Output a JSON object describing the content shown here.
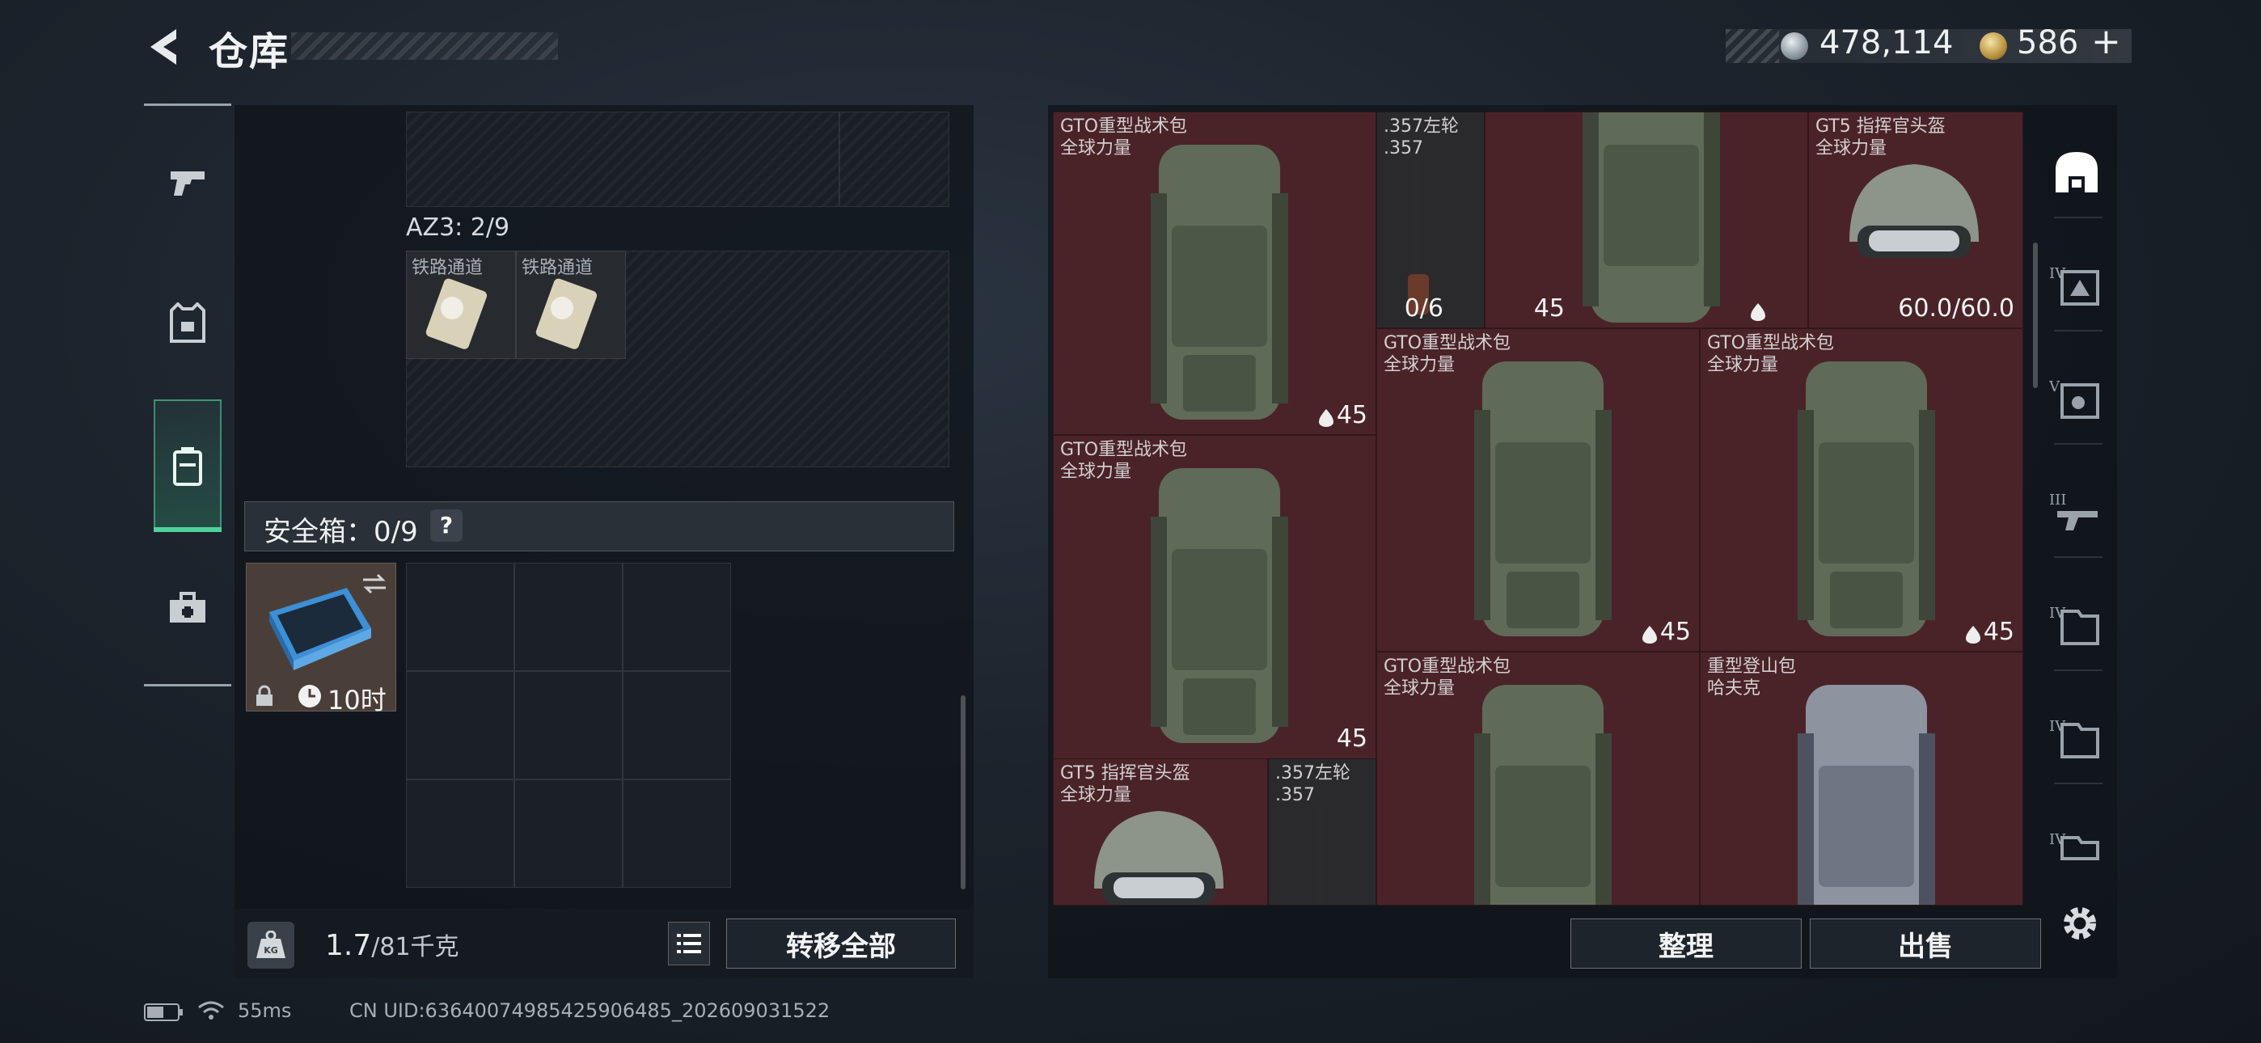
{
  "header": {
    "title": "仓库",
    "currency_silver": "478,114",
    "currency_gold": "586",
    "add_symbol": "+"
  },
  "left_nav": {
    "items": [
      {
        "icon": "pistol-icon"
      },
      {
        "icon": "vest-icon"
      },
      {
        "icon": "backpack-icon",
        "active": true
      },
      {
        "icon": "medkit-icon"
      }
    ]
  },
  "loadout": {
    "az3_label": "AZ3: 2/9",
    "az3_items": [
      {
        "name": "铁路通道"
      },
      {
        "name": "铁路通道"
      }
    ],
    "safe_label": "安全箱：0/9",
    "help": "?",
    "safebox_timer": "10时",
    "weight": "1.7",
    "weight_unit": "/81千克",
    "transfer_all": "转移全部"
  },
  "stash": {
    "items": [
      {
        "name": "GTO重型战术包",
        "sub": "全球力量",
        "value": "45"
      },
      {
        "name": ".357左轮",
        "sub": ".357",
        "value": "0/6"
      },
      {
        "name": "",
        "sub": "",
        "value": "45"
      },
      {
        "name": "GT5 指挥官头盔",
        "sub": "全球力量",
        "value": "60.0/60.0"
      },
      {
        "name": "GTO重型战术包",
        "sub": "全球力量",
        "value": "45"
      },
      {
        "name": "GTO重型战术包",
        "sub": "全球力量",
        "value": "45"
      },
      {
        "name": "GTO重型战术包",
        "sub": "全球力量",
        "value": "45"
      },
      {
        "name": "GTO重型战术包",
        "sub": "全球力量",
        "value": ""
      },
      {
        "name": "重型登山包",
        "sub": "哈夫克",
        "value": ""
      },
      {
        "name": "GT5 指挥官头盔",
        "sub": "全球力量",
        "value": ""
      },
      {
        "name": ".357左轮",
        "sub": ".357",
        "value": ""
      }
    ],
    "organize": "整理",
    "sell": "出售"
  },
  "right_tabs": [
    {
      "icon": "all-items-icon",
      "tier": ""
    },
    {
      "icon": "armor-tier-icon",
      "tier": "IV"
    },
    {
      "icon": "gear-tier-icon",
      "tier": "V"
    },
    {
      "icon": "weapon-tier-icon",
      "tier": "III"
    },
    {
      "icon": "case-tier-icon",
      "tier": "IV"
    },
    {
      "icon": "case-tier-icon",
      "tier": "IV"
    },
    {
      "icon": "case-tier-icon",
      "tier": "IV"
    }
  ],
  "status_bar": {
    "ping": "55ms",
    "uid": "CN UID:6364007498542590​6485_202609031522"
  },
  "colors": {
    "accent_green": "#4fd39a",
    "stash_red": "#4a2328",
    "panel": "#10141a"
  }
}
